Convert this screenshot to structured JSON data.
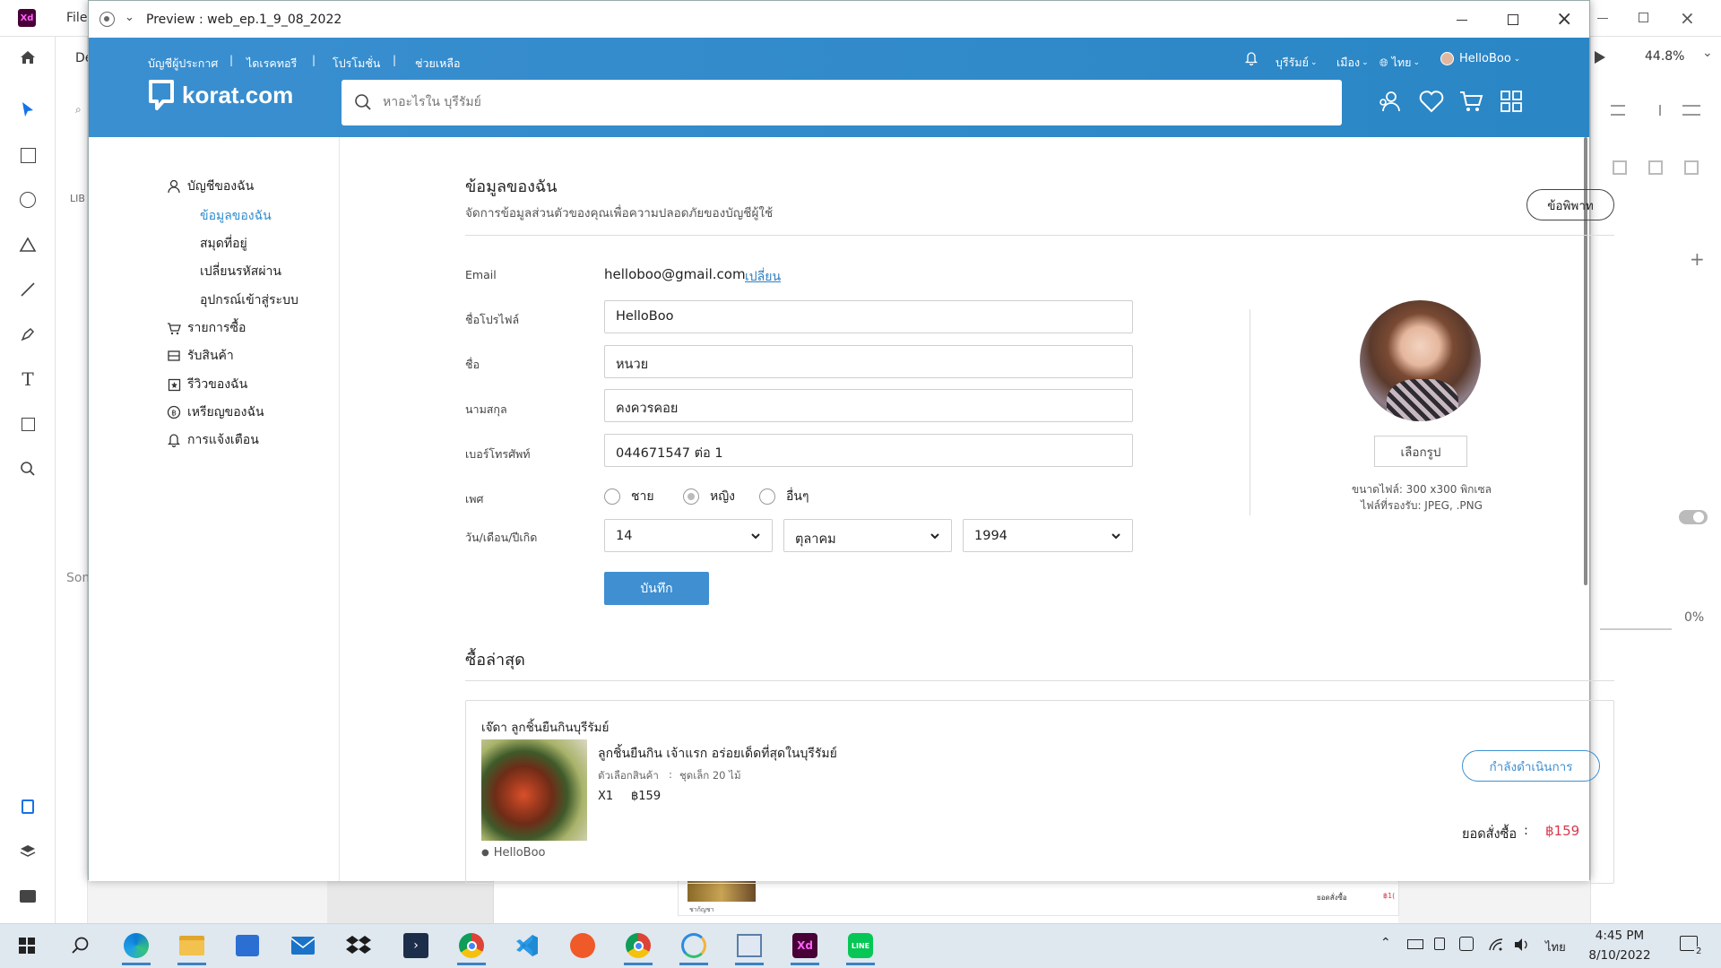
{
  "xd": {
    "menu_file": "File",
    "tab_design_partial": "De",
    "libraries_partial": "LIB",
    "some_partial": "Som",
    "zoom": "44.8%",
    "opacity": "0%"
  },
  "preview_window": {
    "title": "Preview : web_ep.1_9_08_2022"
  },
  "site": {
    "top_links": [
      "บัญชีผู้ประกาศ",
      "ไดเรคทอรี",
      "โปรโมชั่น",
      "ช่วยเหลือ"
    ],
    "separator": "|",
    "province": "บุรีรัมย์",
    "city": "เมือง",
    "language": "ไทย",
    "username": "HelloBoo",
    "logo_text": "korat.com",
    "search_placeholder": "หาอะไรใน บุรีรัมย์"
  },
  "sidebar": {
    "account_label": "บัญชีของฉัน",
    "sub_items": [
      "ข้อมูลของฉัน",
      "สมุดที่อยู่",
      "เปลี่ยนรหัสผ่าน",
      "อุปกรณ์เข้าสู่ระบบ"
    ],
    "items": [
      "รายการซื้อ",
      "รับสินค้า",
      "รีวิวของฉัน",
      "เหรียญของฉัน",
      "การแจ้งเตือน"
    ]
  },
  "profile": {
    "heading": "ข้อมูลของฉัน",
    "subheading": "จัดการข้อมูลส่วนตัวของคุณเพื่อความปลอดภัยของบัญชีผู้ใช้",
    "dispute_button": "ข้อพิพาท",
    "email_label": "Email",
    "email_value": "helloboo@gmail.com",
    "change_link": "เปลี่ยน",
    "profile_name_label": "ชื่อโปรไฟล์",
    "profile_name_value": "HelloBoo",
    "first_name_label": "ชื่อ",
    "first_name_value": "หนวย",
    "last_name_label": "นามสกุล",
    "last_name_value": "คงควรคอย",
    "phone_label": "เบอร์โทรศัพท์",
    "phone_value": "044671547 ต่อ 1",
    "gender_label": "เพศ",
    "gender_options": [
      "ชาย",
      "หญิง",
      "อื่นๆ"
    ],
    "dob_label": "วัน/เดือน/ปีเกิด",
    "dob_day": "14",
    "dob_month": "ตุลาคม",
    "dob_year": "1994",
    "save_button": "บันทึก",
    "choose_photo_button": "เลือกรูป",
    "photo_size_note": "ขนาดไฟล์: 300 x300 พิกเซล",
    "photo_format_note": "ไฟล์ที่รองรับ: JPEG, .PNG"
  },
  "recent": {
    "heading": "ซื้อล่าสุด",
    "shop_name": "เจ๊ดา ลูกชิ้นยืนกินบุรีรัมย์",
    "product_name": "ลูกชิ้นยืนกิน เจ้าแรก อร่อยเด็ดที่สุดในบุรีรัมย์",
    "option_label": "ตัวเลือกสินค้า",
    "option_colon": ":",
    "option_value": "ชุดเล็ก 20 ไม้",
    "quantity": "X1",
    "price": "฿159",
    "status_button": "กำลังดำเนินการ",
    "total_label": "ยอดสั่งซื้อ",
    "total_colon": ":",
    "total_value": "฿159",
    "buyer": "HelloBoo",
    "bg_total_label": "ยอดสั่งซื้อ",
    "bg_total_value": "฿1(",
    "bg_shop_partial": "ชาก้ญชา"
  },
  "taskbar": {
    "language": "ไทย",
    "time": "4:45 PM",
    "date": "8/10/2022",
    "notification_count": "2"
  },
  "colors": {
    "brand_blue": "#2f8ccc",
    "save_blue": "#3f8fd1",
    "link_blue": "#2f7fc0",
    "price_red": "#d9374b",
    "xd_purple": "#470137"
  }
}
